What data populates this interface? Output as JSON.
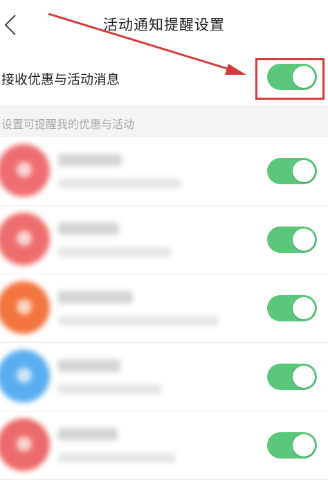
{
  "header": {
    "title": "活动通知提醒设置",
    "back_icon": "chevron-left-icon"
  },
  "master_setting": {
    "label": "接收优惠与活动消息",
    "enabled": true
  },
  "section": {
    "label": "设置可提醒我的优惠与活动"
  },
  "merchants": [
    {
      "logo_color": "#ef6e72",
      "enabled": true
    },
    {
      "logo_color": "#ee6e6e",
      "enabled": true
    },
    {
      "logo_color": "#f3753f",
      "enabled": true
    },
    {
      "logo_color": "#5aaef0",
      "enabled": true
    },
    {
      "logo_color": "#ec6a6a",
      "enabled": true
    }
  ],
  "colors": {
    "toggle_on": "#5ac77a",
    "highlight": "#d63a3a",
    "section_bg": "#f4f4f4"
  }
}
